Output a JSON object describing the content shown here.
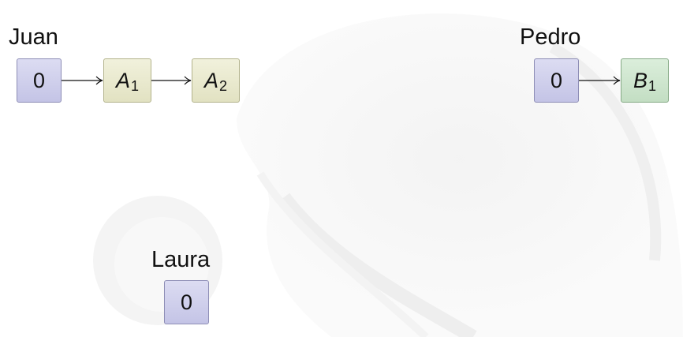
{
  "lists": [
    {
      "name": "Juan",
      "nodes": [
        {
          "kind": "start",
          "text": "0"
        },
        {
          "kind": "item",
          "var": "A",
          "sub": "1",
          "color": "#e8e8cc"
        },
        {
          "kind": "item",
          "var": "A",
          "sub": "2",
          "color": "#e8e8cc"
        }
      ]
    },
    {
      "name": "Pedro",
      "nodes": [
        {
          "kind": "start",
          "text": "0"
        },
        {
          "kind": "item",
          "var": "B",
          "sub": "1",
          "color": "#cfe5cf"
        }
      ]
    },
    {
      "name": "Laura",
      "nodes": [
        {
          "kind": "start",
          "text": "0"
        }
      ]
    }
  ],
  "colors": {
    "start_node": "#cfcfec",
    "a_node": "#e8e8cc",
    "b_node": "#cfe5cf",
    "arrow": "#111111"
  }
}
